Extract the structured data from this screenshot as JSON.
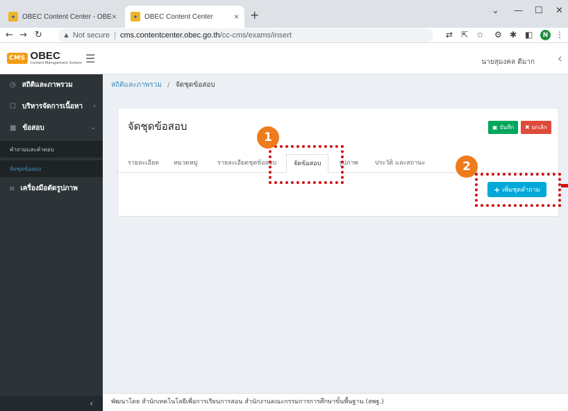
{
  "browser": {
    "tabs": [
      {
        "title": "OBEC Content Center - OBEC",
        "close": "×"
      },
      {
        "title": "OBEC Content Center",
        "close": "×"
      }
    ],
    "new_tab": "+",
    "window_controls": [
      "⌄",
      "—",
      "☐",
      "✕"
    ],
    "not_secure": "Not secure",
    "url_host": "cms.contentcenter.obec.go.th",
    "url_path": "/cc-cms/exams/insert",
    "profile_initial": "N"
  },
  "header": {
    "logo_badge": "CMS",
    "logo_title": "OBEC",
    "logo_subtitle": "Content Management System",
    "username": "นายสุมงคล ดีมาก"
  },
  "sidebar": {
    "items": [
      {
        "label": "สถิติและภาพรวม",
        "icon": "dashboard-icon"
      },
      {
        "label": "บริหารจัดการเนื้อหา",
        "icon": "content-icon"
      },
      {
        "label": "ข้อสอบ",
        "icon": "exam-icon"
      },
      {
        "label": "เครื่องมือตัดรูปภาพ",
        "icon": "crop-icon"
      }
    ],
    "subitems": [
      {
        "label": "คำถามและคำตอบ"
      },
      {
        "label": "จัดชุดข้อสอบ"
      }
    ]
  },
  "breadcrumb": {
    "root": "สถิติและภาพรวม",
    "separator": "/",
    "current": "จัดชุดข้อสอบ"
  },
  "panel": {
    "title": "จัดชุดข้อสอบ",
    "save_label": "บันทึก",
    "cancel_label": "ยกเลิก",
    "tabs": [
      "รายละเอียด",
      "หมวดหมู่",
      "รายละเอียดชุดข้อสอบ",
      "จัดข้อสอบ",
      "รูปภาพ",
      "ประวัติ และสถานะ"
    ],
    "active_tab": "จัดข้อสอบ",
    "add_label": "เพิ่มชุดคำถาม"
  },
  "annotations": {
    "step1": "1",
    "step2": "2",
    "color": "#d01010",
    "badge_color": "#ee7b1c"
  },
  "footer": {
    "text": "พัฒนาโดย สำนักเทคโนโลยีเพื่อการเรียนการสอน สำนักงานคณะกรรมการการศึกษาขั้นพื้นฐาน (สพฐ.)"
  }
}
